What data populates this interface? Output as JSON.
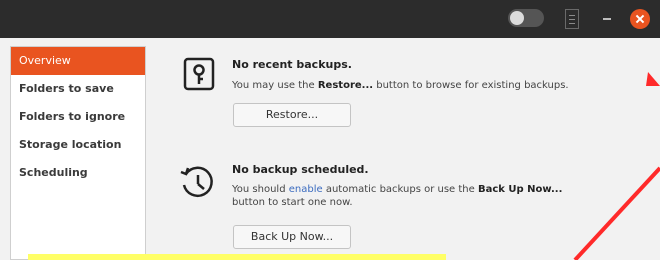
{
  "sidebar": {
    "items": [
      {
        "label": "Overview",
        "active": true
      },
      {
        "label": "Folders to save",
        "active": false
      },
      {
        "label": "Folders to ignore",
        "active": false
      },
      {
        "label": "Storage location",
        "active": false
      },
      {
        "label": "Scheduling",
        "active": false
      }
    ]
  },
  "backup": {
    "icon": "safe-icon",
    "title": "No recent backups.",
    "text_before": "You may use the ",
    "text_bold": "Restore...",
    "text_after": " button to browse for existing backups.",
    "button_label": "Restore..."
  },
  "schedule": {
    "icon": "history-clock-icon",
    "title": "No backup scheduled.",
    "text_before": "You should ",
    "text_link": "enable",
    "text_middle": " automatic backups or use the ",
    "text_bold": "Back Up Now...",
    "text_after": " button to start one now.",
    "button_label": "Back Up Now..."
  },
  "annotations": {
    "arrow_color": "#ff2a2a",
    "highlight_color": "#ffff66"
  },
  "colors": {
    "accent": "#e95420",
    "titlebar": "#2c2c2c"
  }
}
